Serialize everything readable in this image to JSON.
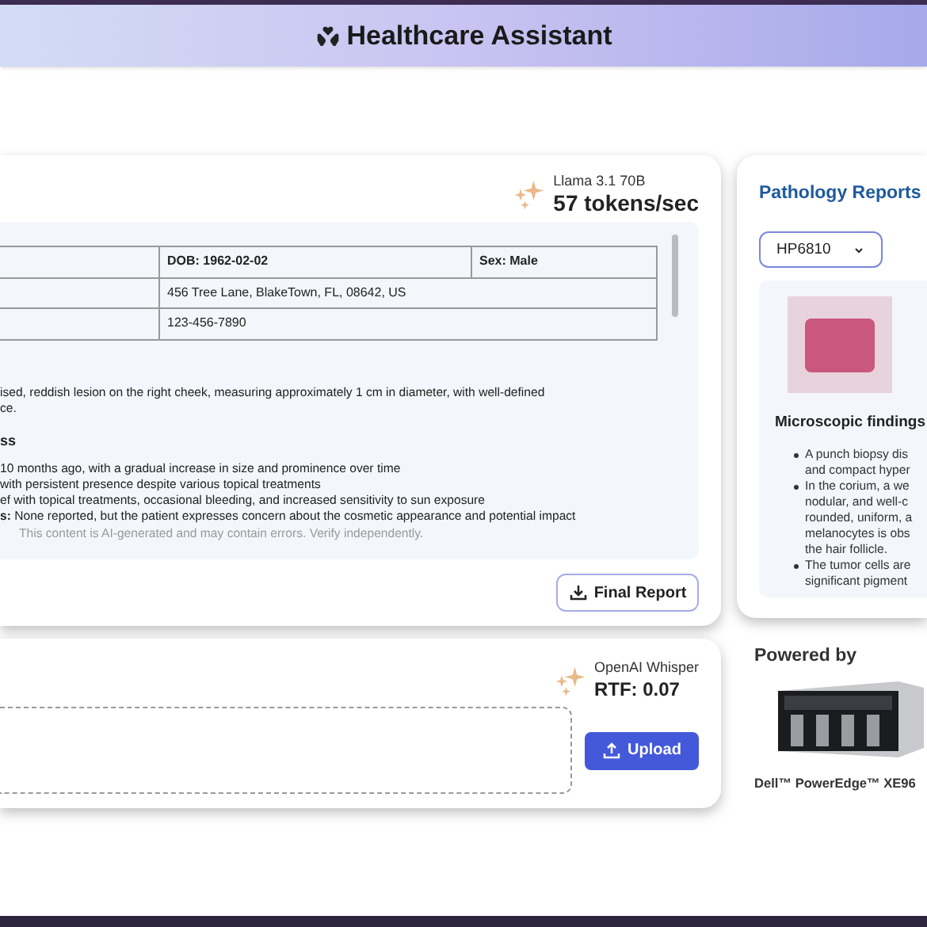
{
  "header": {
    "title": "Healthcare Assistant"
  },
  "report_panel": {
    "model": {
      "name": "Llama 3.1 70B",
      "speed": "57 tokens/sec"
    },
    "patient_table": {
      "rows": [
        [
          {
            "text": "DOB: 1962-02-02"
          },
          {
            "text": "Sex: Male"
          }
        ],
        [
          {
            "text": "456 Tree Lane, BlakeTown, FL, 08642, US",
            "colspan": 2
          }
        ],
        [
          {
            "text": "123-456-7890",
            "colspan": 2
          }
        ]
      ]
    },
    "paragraph_lines": [
      "ised, reddish lesion on the right cheek, measuring approximately 1 cm in diameter, with well-defined",
      "ce."
    ],
    "section_heading": "ss",
    "list_lines": [
      "10 months ago, with a gradual increase in size and prominence over time",
      "with persistent presence despite various topical treatments",
      "ef with topical treatments, occasional bleeding, and increased sensitivity to sun exposure",
      "**s:** None reported, but the patient expresses concern about the cosmetic appearance and potential impact"
    ],
    "disclaimer": "This content is AI-generated and may contain errors. Verify independently.",
    "final_report_button": "Final Report"
  },
  "pathology": {
    "title": "Pathology Reports",
    "select_value": "HP6810",
    "findings_title": "Microscopic findings",
    "bullets": [
      [
        "A punch biopsy dis",
        "and compact hyper"
      ],
      [
        "In the corium, a we",
        "nodular, and well-c",
        "rounded, uniform, a",
        "melanocytes is obs",
        "the hair follicle."
      ],
      [
        "The tumor cells are",
        "significant pigment"
      ]
    ]
  },
  "transcription_panel": {
    "model": {
      "name": "OpenAI Whisper",
      "speed": "RTF: 0.07"
    },
    "upload_button": "Upload"
  },
  "powered_by": {
    "title": "Powered by",
    "product": "Dell™ PowerEdge™ XE96"
  }
}
